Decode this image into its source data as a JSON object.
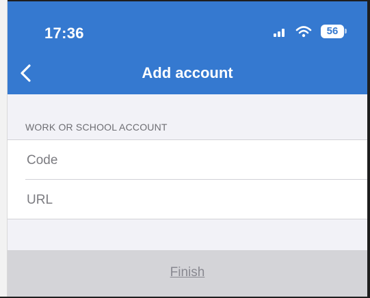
{
  "status_bar": {
    "time": "17:36",
    "battery_level": "56",
    "signal_bars": 3,
    "signal_icon": "cellular-signal-icon",
    "wifi_icon": "wifi-icon"
  },
  "nav": {
    "title": "Add account",
    "back_icon": "chevron-left-icon"
  },
  "section": {
    "header": "WORK OR SCHOOL ACCOUNT"
  },
  "fields": {
    "code": {
      "value": "",
      "placeholder": "Code"
    },
    "url": {
      "value": "",
      "placeholder": "URL"
    }
  },
  "actions": {
    "finish_label": "Finish"
  },
  "colors": {
    "header_bg": "#3579d0",
    "page_bg": "#f2f2f7",
    "finish_bar_bg": "#d4d4d8",
    "section_text": "#6d6d72"
  }
}
